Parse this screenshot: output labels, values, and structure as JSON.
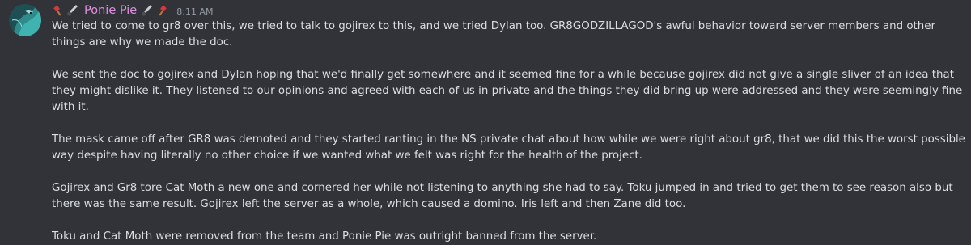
{
  "message": {
    "author": "Ponie Pie",
    "timestamp": "8:11 AM",
    "author_color": "#e08ee0",
    "name_decoration_icons": [
      "axe-icon",
      "knife-icon",
      "knife-icon",
      "axe-icon"
    ],
    "paragraphs": [
      "We tried to come to gr8 over this, we tried to talk to gojirex to this, and we tried Dylan too. GR8GODZILLAGOD's awful behavior toward server members and other things are why we made the doc.",
      "We sent the doc to gojirex and Dylan hoping that we'd finally get somewhere and it seemed fine for a while because gojirex did not give a single sliver of an idea that they might dislike it. They listened to our opinions and agreed with each of us in private and the things they did bring up were addressed and they were seemingly fine with it.",
      "The mask came off after GR8 was demoted and they started ranting in the NS private chat about how while we were right about gr8, that we did this the worst possible way despite having literally no other choice if we wanted what we felt was right for the health of the project.",
      "Gojirex and Gr8 tore Cat Moth a new one and cornered her while not listening to anything she had to say. Toku jumped in and tried to get them to see reason also but there was the same result. Gojirex left the server as a whole, which caused a domino. Iris left and then Zane did too.",
      "Toku and Cat Moth were removed from the team and Ponie Pie was outright banned from the server."
    ]
  },
  "theme": {
    "background": "#313338",
    "text": "#dbdee1",
    "muted": "#949ba4"
  }
}
